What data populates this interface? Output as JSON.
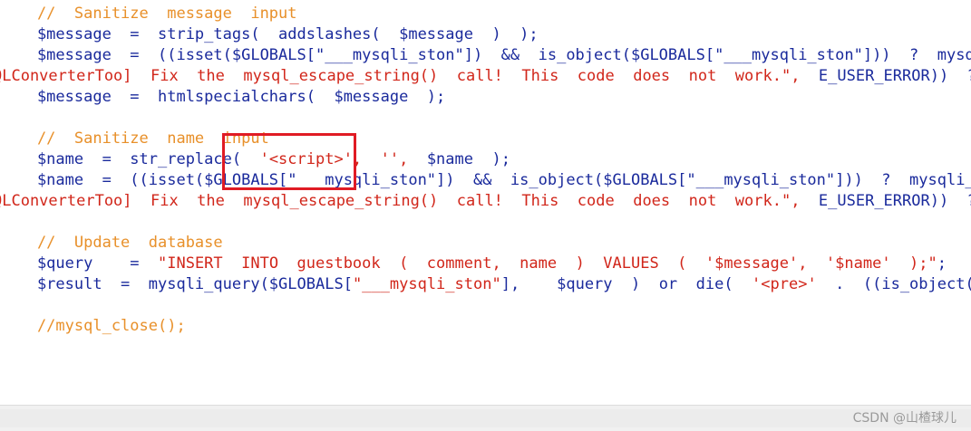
{
  "code": {
    "line1": "    //  Sanitize  message  input",
    "line2": "    $message  =  strip_tags(  addslashes(  $message  )  );",
    "line3_a": "    $message  =  ((isset($GLOBALS[\"___mysqli_ston\"])  &&  is_object($GLOBALS[\"___mysqli_ston\"]))  ?  mysqli_real_escape_string(",
    "line4_a": "QLConverterToo]  Fix  the  mysql_escape_string()  call!  This  code  does  not  work.\",  ",
    "line4_b": "E_USER_ERROR))  ?  \"\"  :  \"\"));",
    "line5": "    $message  =  htmlspecialchars(  $message  );",
    "line6": "",
    "line7": "    //  Sanitize  name  input",
    "line8_a": "    $name  =  str_replace(  ",
    "line8_b": "'<script>',  '',",
    "line8_c": "  $name  );",
    "line9": "    $name  =  ((isset($GLOBALS[\"___mysqli_ston\"])  &&  is_object($GLOBALS[\"___mysqli_ston\"]))  ?  mysqli_real_escape_string(",
    "line10_a": "QLConverterToo]  Fix  the  mysql_escape_string()  call!  This  code  does  not  work.\",  ",
    "line10_b": "E_USER_ERROR))  ?  \"\"  :  \"\"));",
    "line11": "",
    "line12": "    //  Update  database",
    "line13_a": "    $query    =  ",
    "line13_b": "\"INSERT  INTO  guestbook  (  comment,  name  )  VALUES  (  '$message',  '$name'  );\"",
    "line13_c": ";",
    "line14_a": "    $result  =  mysqli_query($GLOBALS[",
    "line14_b": "\"___mysqli_ston\"",
    "line14_c": "],    $query  )  or  die(  ",
    "line14_d": "'<pre>'",
    "line14_e": "  .  ((is_object($GLOBALS[\"___mysqli_ston\"]))  ?",
    "line15": "",
    "line16": "    //mysql_close();"
  },
  "watermark": "CSDN @山楂球儿",
  "colors": {
    "comment": "#e8902a",
    "code": "#1a2a9c",
    "string": "#d1261a",
    "highlight": "#e01b24"
  }
}
